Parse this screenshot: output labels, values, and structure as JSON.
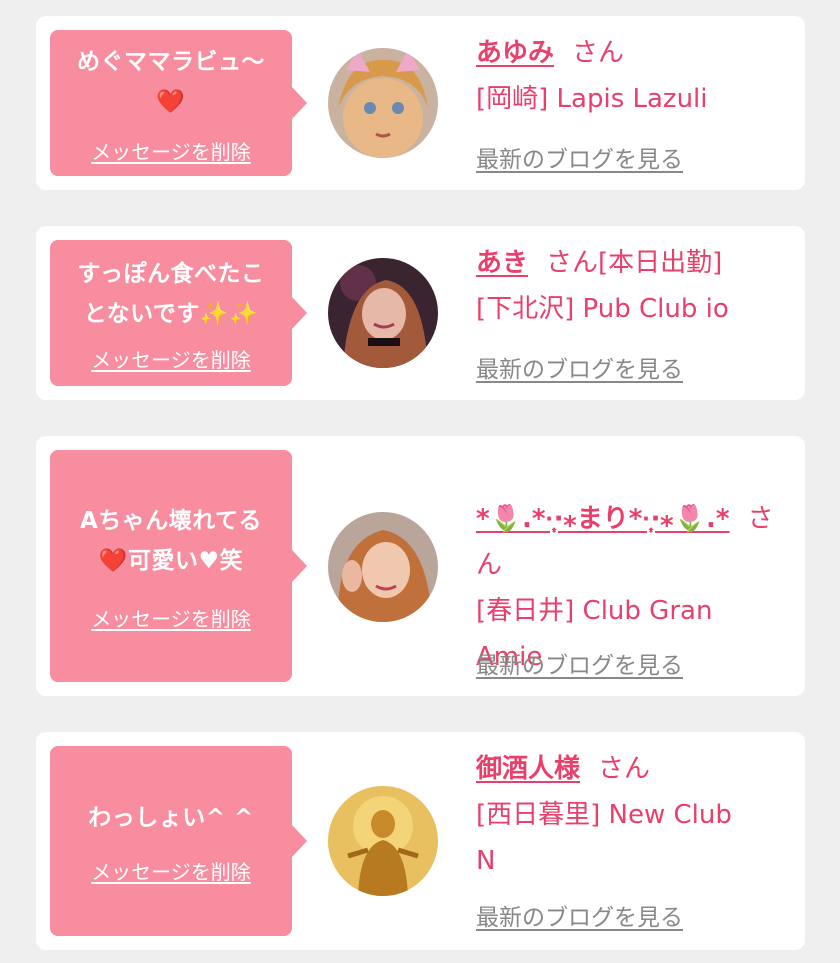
{
  "cards": [
    {
      "message": "めぐママラビュ〜\n❤️",
      "delete_label": "メッセージを削除",
      "name": "あゆみ",
      "honorific": "さん",
      "shop": "[岡崎] Lapis Lazuli",
      "blog_link": "最新のブログを見る",
      "avatar_icon": "profile-photo-blonde"
    },
    {
      "message": "すっぽん食べたこ\nとないです✨✨",
      "delete_label": "メッセージを削除",
      "name": "あき",
      "honorific": "さん[本日出勤]",
      "shop": "[下北沢] Pub Club io",
      "blog_link": "最新のブログを見る",
      "avatar_icon": "profile-photo-dark"
    },
    {
      "message": "Aちゃん壊れてる\n❤️可愛い♥笑",
      "delete_label": "メッセージを削除",
      "name": "*🌷.*·̩͙‧⁎まり*·̩͙‧⁎🌷.*",
      "honorific": "さ\nん",
      "shop": "[春日井] Club Gran\nAmie",
      "blog_link": "最新のブログを見る",
      "avatar_icon": "profile-photo-light"
    },
    {
      "message": "わっしょい^ ^",
      "delete_label": "メッセージを削除",
      "name": "御酒人様",
      "honorific": "さん",
      "shop": "[西日暮里] New Club\nN",
      "blog_link": "最新のブログを見る",
      "avatar_icon": "profile-photo-golden-statue"
    }
  ],
  "colors": {
    "bubble": "#f78d9f",
    "accent_text": "#e8406b",
    "link_gray": "#888888",
    "background": "#efefef"
  }
}
